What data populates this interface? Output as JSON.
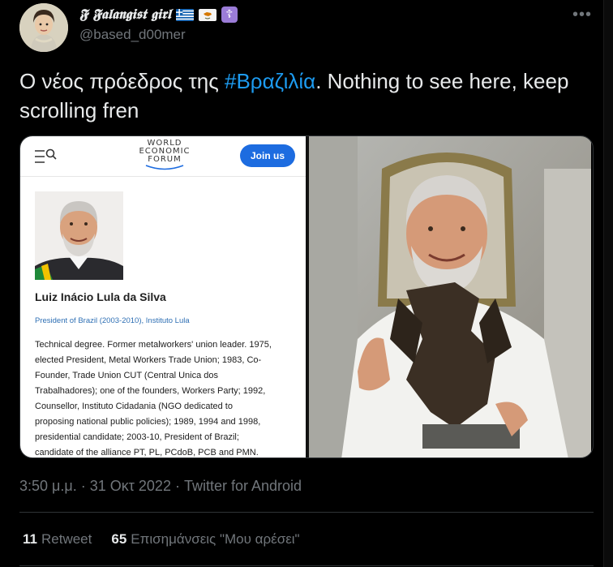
{
  "author": {
    "display_name": "𝕱 𝕱𝖆𝖑𝖆𝖓𝖌𝖎𝖘𝖙 𝖌𝖎𝖗𝖑",
    "handle": "@based_d00mer",
    "badges": [
      "greece-flag-icon",
      "cyprus-flag-icon",
      "orthodox-cross-icon"
    ],
    "cross_glyph": "☦"
  },
  "more_glyph": "•••",
  "tweet": {
    "text_before": "Ο νέος πρόεδρος της ",
    "hashtag": "#Βραζιλία",
    "text_after": ". Nothing to see here, keep scrolling fren"
  },
  "media": {
    "wef": {
      "logo_line1": "WORLD",
      "logo_line2": "ECONOMIC",
      "logo_line3": "FORUM",
      "join_label": "Join us",
      "person_name": "Luiz Inácio Lula da Silva",
      "person_role": "President of Brazil (2003-2010), Instituto Lula",
      "bio_lines": [
        "Technical degree. Former metalworkers' union leader. 1975,",
        "elected President, Metal Workers Trade Union; 1983, Co-",
        "Founder, Trade Union CUT (Central Unica dos",
        "Trabalhadores); one of the founders, Workers Party; 1992,",
        "Counsellor, Instituto Cidadania (NGO dedicated to",
        "proposing national public policies); 1989, 1994 and 1998,",
        "presidential candidate; 2003-10, President of Brazil;",
        "candidate of the alliance PT, PL, PCdoB, PCB and PMN."
      ]
    }
  },
  "timestamp": "3:50 μ.μ. · 31 Οκτ 2022 · Twitter for Android",
  "stats": {
    "retweets_count": "11",
    "retweets_label": "Retweet",
    "likes_count": "65",
    "likes_label": "Επισημάνσεις \"Μου αρέσει\""
  },
  "colors": {
    "accent": "#1d9bf0",
    "background": "#000000",
    "secondary_text": "#71767b"
  }
}
